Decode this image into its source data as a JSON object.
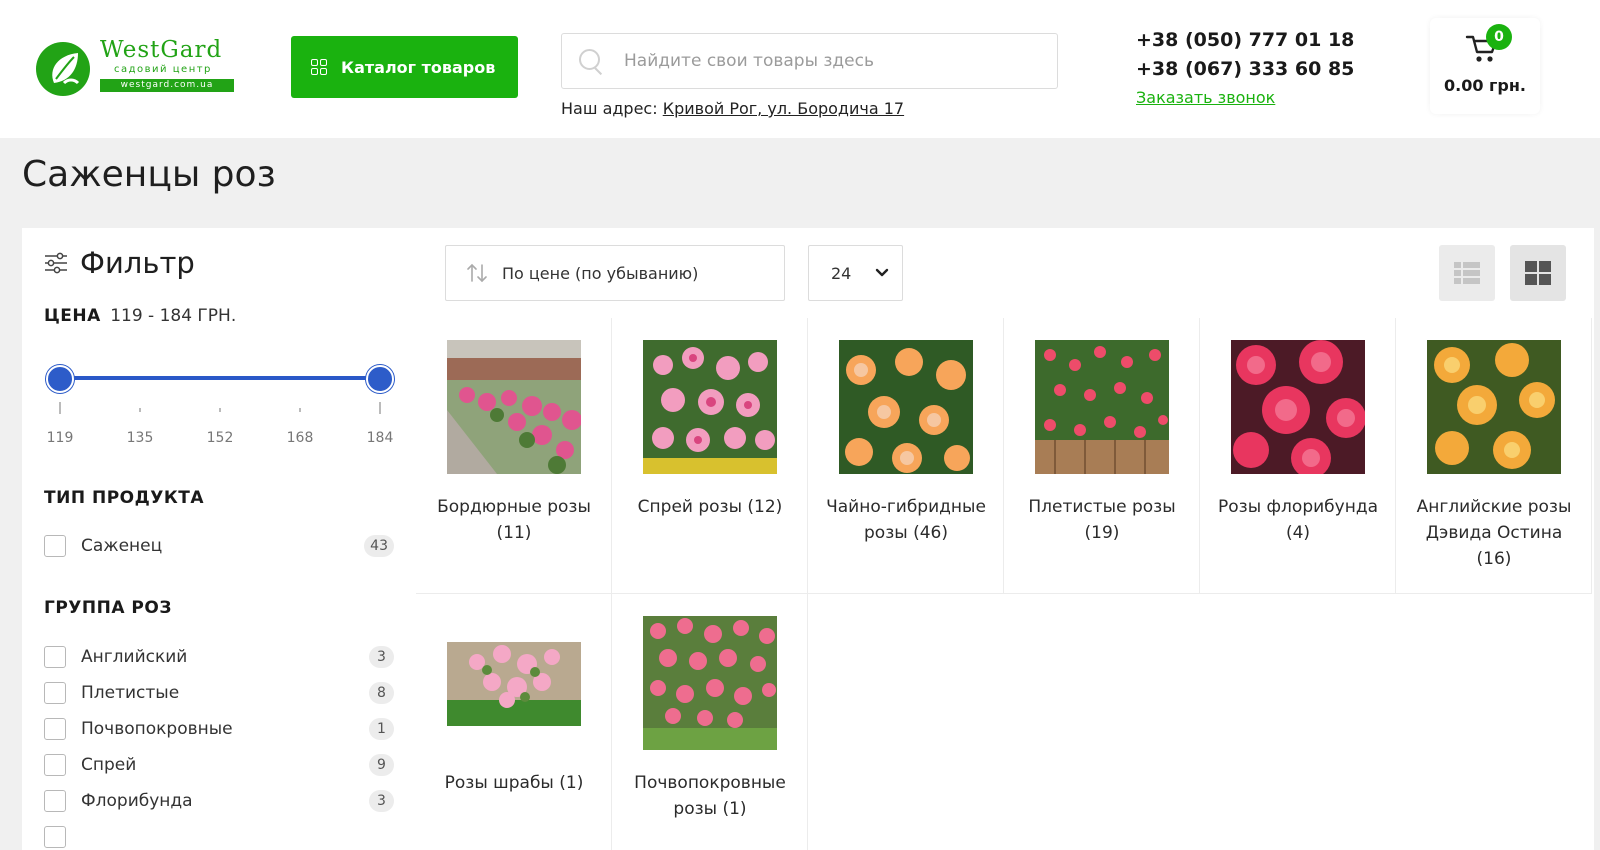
{
  "header": {
    "logo": {
      "name": "WestGard",
      "subtitle": "садовий центр",
      "url": "westgard.com.ua"
    },
    "catalog_button": "Каталог товаров",
    "search": {
      "placeholder": "Найдите свои товары здесь",
      "value": ""
    },
    "address_label": "Наш адрес:",
    "address_link": "Кривой Рог, ул. Бородича 17",
    "phones": [
      "+38 (050) 777 01 18",
      "+38 (067) 333 60 85"
    ],
    "callback_link": "Заказать звонок",
    "cart": {
      "count": "0",
      "total": "0.00 грн."
    }
  },
  "page_title": "Саженцы роз",
  "filter": {
    "title": "Фильтр",
    "price": {
      "label": "ЦЕНА",
      "range_text": "119 - 184 ГРН.",
      "min": 119,
      "max": 184,
      "selected_min": 119,
      "selected_max": 184,
      "ticks": [
        "119",
        "135",
        "152",
        "168",
        "184"
      ]
    },
    "product_type": {
      "title": "ТИП ПРОДУКТА",
      "options": [
        {
          "label": "Саженец",
          "count": "43"
        }
      ]
    },
    "rose_group": {
      "title": "ГРУППА РОЗ",
      "options": [
        {
          "label": "Английский",
          "count": "3"
        },
        {
          "label": "Плетистые",
          "count": "8"
        },
        {
          "label": "Почвопокровные",
          "count": "1"
        },
        {
          "label": "Спрей",
          "count": "9"
        },
        {
          "label": "Флорибунда",
          "count": "3"
        }
      ]
    }
  },
  "toolbar": {
    "sort_label": "По цене (по убыванию)",
    "per_page": "24"
  },
  "categories": [
    {
      "title": "Бордюрные розы (11)"
    },
    {
      "title": "Спрей розы (12)"
    },
    {
      "title": "Чайно-гибридные розы (46)"
    },
    {
      "title": "Плетистые розы (19)"
    },
    {
      "title": "Розы флорибунда (4)"
    },
    {
      "title": "Английские розы Дэвида Остина (16)"
    },
    {
      "title": "Розы шрабы (1)"
    },
    {
      "title": "Почвопокровные розы (1)"
    }
  ],
  "colors": {
    "brand_green": "#1ab20f",
    "slider_blue": "#2d5cc9",
    "page_bg": "#f0f0f0"
  }
}
